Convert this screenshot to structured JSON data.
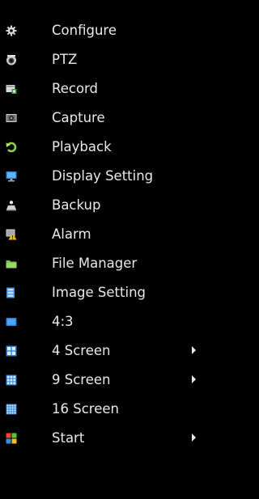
{
  "menu": {
    "items": [
      {
        "label": "Configure",
        "icon": "gear-icon"
      },
      {
        "label": "PTZ",
        "icon": "ptz-camera-icon"
      },
      {
        "label": "Record",
        "icon": "record-icon"
      },
      {
        "label": "Capture",
        "icon": "camera-icon"
      },
      {
        "label": "Playback",
        "icon": "playback-icon"
      },
      {
        "label": "Display Setting",
        "icon": "monitor-icon"
      },
      {
        "label": "Backup",
        "icon": "backup-icon"
      },
      {
        "label": "Alarm",
        "icon": "alarm-warning-icon"
      },
      {
        "label": "File Manager",
        "icon": "folder-icon"
      },
      {
        "label": "Image Setting",
        "icon": "image-setting-icon"
      },
      {
        "label": "4:3",
        "icon": "aspect-ratio-icon"
      },
      {
        "label": "4 Screen",
        "icon": "grid-4-icon"
      },
      {
        "label": "9 Screen",
        "icon": "grid-9-icon"
      },
      {
        "label": "16 Screen",
        "icon": "grid-16-icon"
      },
      {
        "label": "Start",
        "icon": "start-icon"
      }
    ]
  }
}
